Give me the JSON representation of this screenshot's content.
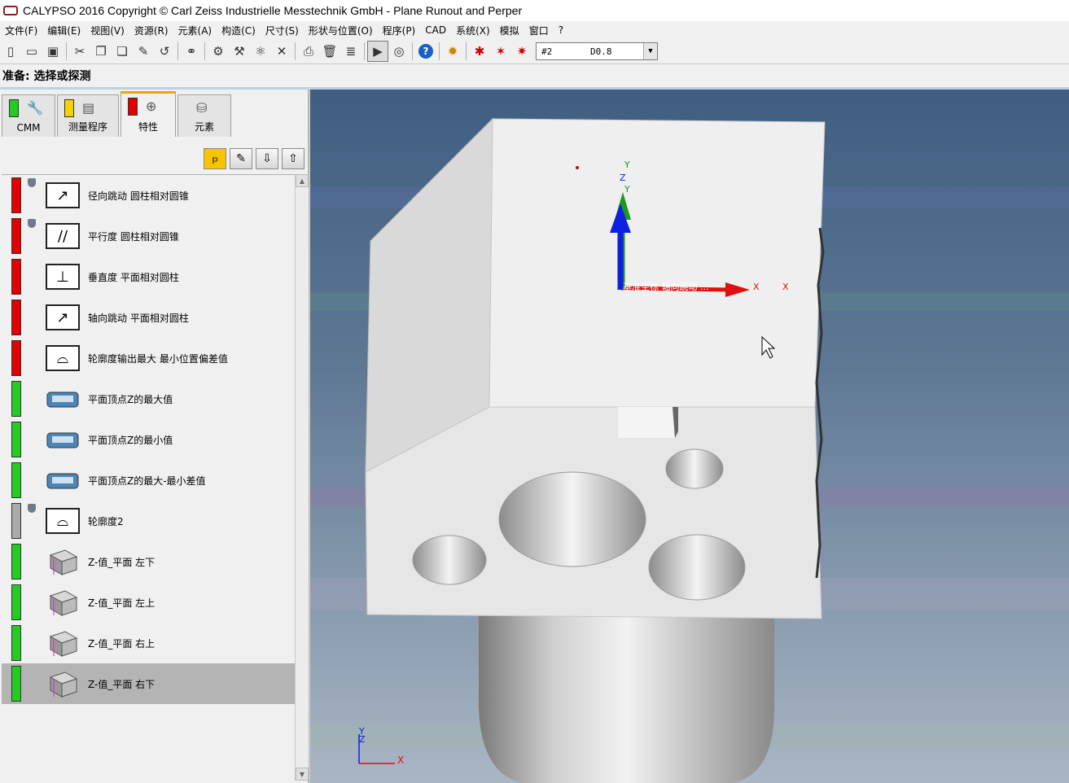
{
  "window": {
    "title": "CALYPSO 2016 Copyright © Carl Zeiss Industrielle Messtechnik GmbH - Plane Runout and Perper"
  },
  "menu": {
    "items": [
      "文件(F)",
      "编辑(E)",
      "视图(V)",
      "资源(R)",
      "元素(A)",
      "构造(C)",
      "尺寸(S)",
      "形状与位置(O)",
      "程序(P)",
      "CAD",
      "系统(X)",
      "模拟",
      "窗口",
      "?"
    ]
  },
  "toolbar": {
    "icons": [
      "new-icon",
      "open-icon",
      "save-icon",
      "cut-icon",
      "copy-icon",
      "paste-icon",
      "brush-icon",
      "undo-icon",
      "binoculars-icon",
      "probe-a-icon",
      "probe-b-icon",
      "probe-c-icon",
      "tools-icon",
      "print-icon",
      "delete-icon",
      "report-icon",
      "run-icon",
      "stylus-icon",
      "help-icon",
      "setup-icon",
      "probe-d-icon",
      "probe-e-icon",
      "probe-f-icon"
    ],
    "combo": {
      "probe": "#2",
      "stylus": "D0.8"
    }
  },
  "status_line": "准备: 选择或探测",
  "tabs": [
    {
      "label": "CMM",
      "flag_color": "#22cc22"
    },
    {
      "label": "测量程序",
      "flag_color": "#f2d400"
    },
    {
      "label": "特性",
      "flag_color": "#e00000",
      "active": true
    },
    {
      "label": "元素",
      "flag_color": null
    }
  ],
  "actions": [
    "p",
    "edit",
    "down",
    "up"
  ],
  "features": [
    {
      "label": "径向跳动  圆柱相对圆锥",
      "status": "#e00000",
      "icon": "radial-runout-icon",
      "shield": true
    },
    {
      "label": "平行度  圆柱相对圆锥",
      "status": "#e00000",
      "icon": "parallelism-icon",
      "shield": true
    },
    {
      "label": "垂直度  平面相对圆柱",
      "status": "#e00000",
      "icon": "perpendicularity-icon",
      "shield": false
    },
    {
      "label": "轴向跳动  平面相对圆柱",
      "status": "#e00000",
      "icon": "axial-runout-icon",
      "shield": false
    },
    {
      "label": "轮廓度输出最大 最小位置偏差值",
      "status": "#e00000",
      "icon": "profile-icon",
      "shield": false
    },
    {
      "label": "平面顶点Z的最大值",
      "status": "#22cc22",
      "icon": "formula-icon",
      "shield": false
    },
    {
      "label": "平面顶点Z的最小值",
      "status": "#22cc22",
      "icon": "formula-icon",
      "shield": false
    },
    {
      "label": "平面顶点Z的最大-最小差值",
      "status": "#22cc22",
      "icon": "formula-icon",
      "shield": false
    },
    {
      "label": "轮廓度2",
      "status": "#aaaaaa",
      "icon": "profile-icon",
      "shield": true
    },
    {
      "label": "Z-值_平面  左下",
      "status": "#22cc22",
      "icon": "z-value-plane-icon",
      "shield": false
    },
    {
      "label": "Z-值_平面  左上",
      "status": "#22cc22",
      "icon": "z-value-plane-icon",
      "shield": false
    },
    {
      "label": "Z-值_平面  右上",
      "status": "#22cc22",
      "icon": "z-value-plane-icon",
      "shield": false
    },
    {
      "label": "Z-值_平面  右下",
      "status": "#22cc22",
      "icon": "z-value-plane-icon",
      "shield": false,
      "selected": true
    }
  ],
  "viewport": {
    "axis_labels": {
      "x": "X",
      "y": "Y",
      "z": "Z"
    },
    "overlay_text": "基准坐标 轴向跳动 ...",
    "colors": {
      "bg_top": "#3f5e80",
      "bg_bottom": "#aab6c4",
      "part": "#efefef",
      "x_axis": "#e01010",
      "y_axis": "#1a9a1a",
      "z_axis": "#1020e0"
    }
  }
}
